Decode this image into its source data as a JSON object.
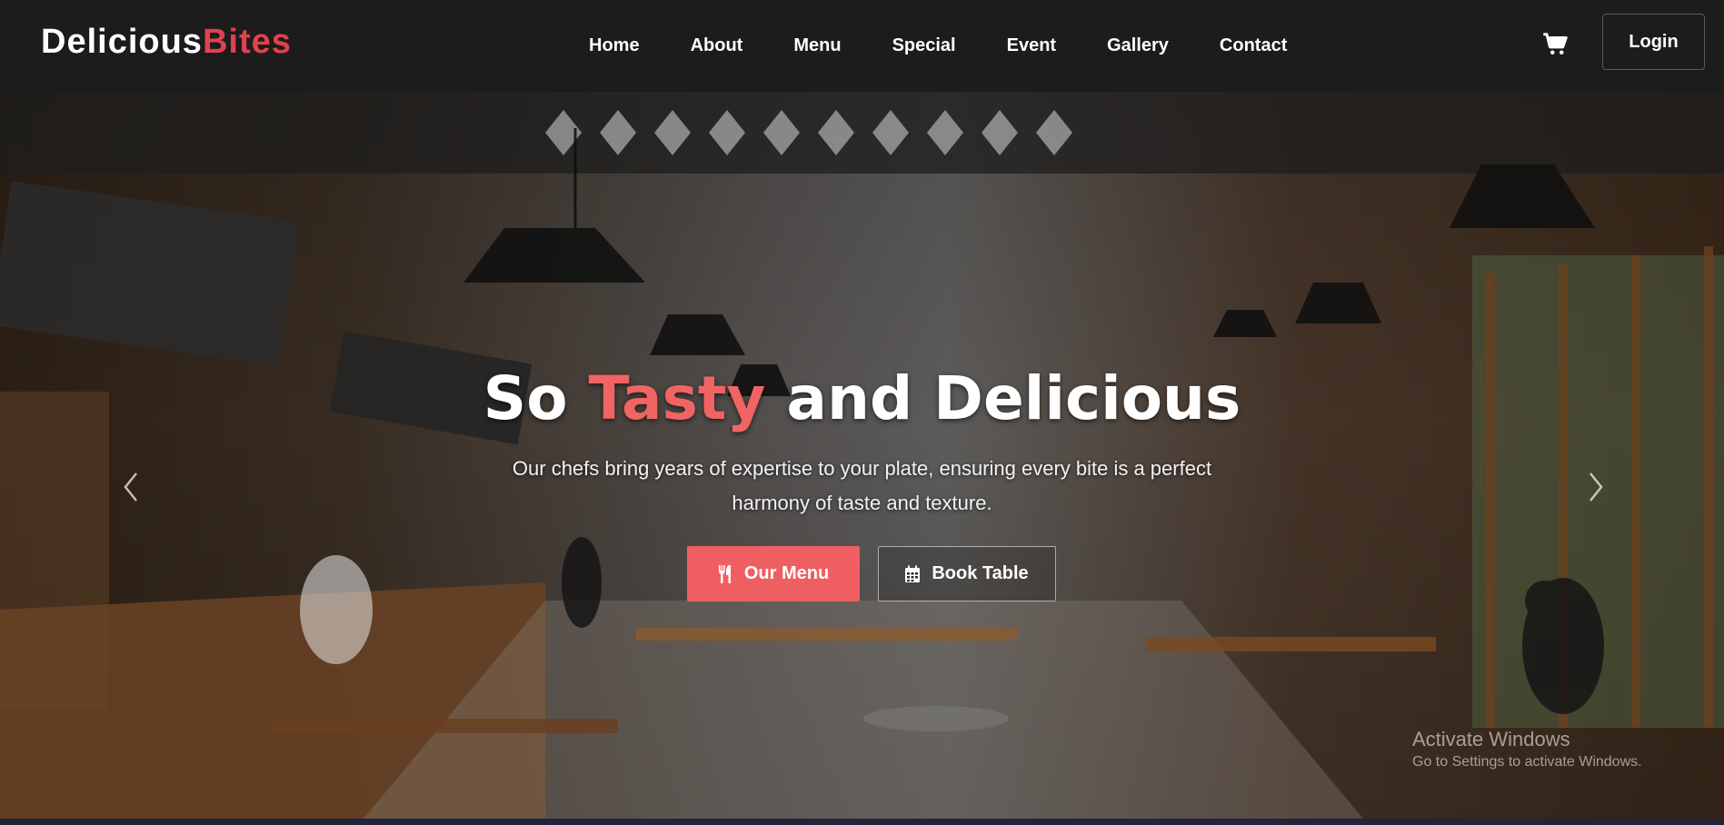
{
  "brand": {
    "part1": "Delicious",
    "part2": "Bites"
  },
  "nav": {
    "links": [
      "Home",
      "About",
      "Menu",
      "Special",
      "Event",
      "Gallery",
      "Contact"
    ],
    "login_label": "Login",
    "cart_icon": "cart-icon"
  },
  "hero": {
    "title_start": "So ",
    "title_accent": "Tasty",
    "title_end": " and Delicious",
    "subtitle": "Our chefs bring years of expertise to your plate, ensuring every bite is a perfect harmony of taste and texture.",
    "primary_button": "Our Menu",
    "primary_icon": "utensils-icon",
    "secondary_button": "Book Table",
    "secondary_icon": "calendar-icon",
    "prev_icon": "chevron-left-icon",
    "next_icon": "chevron-right-icon",
    "background": "restaurant-interior-photo"
  },
  "watermark": {
    "title": "Activate Windows",
    "subtitle": "Go to Settings to activate Windows."
  },
  "colors": {
    "accent": "#e0424f",
    "button": "#ef5f62",
    "navbar": "#1c1c1c"
  }
}
